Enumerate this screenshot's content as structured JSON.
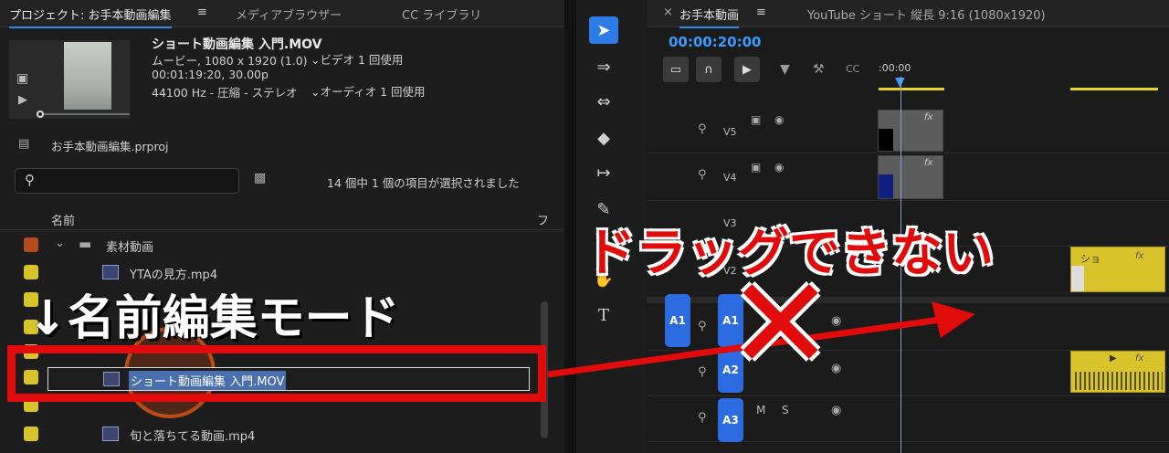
{
  "project_panel": {
    "tabs": [
      "プロジェクト: お手本動画編集",
      "メディアブラウザー",
      "CC ライブラリ"
    ],
    "menu_glyph": "≡",
    "clip_name": "ショート動画編集 入門.MOV",
    "clip_type": "ムービー, 1080 x 1920 (1.0)",
    "video_usage": "ビデオ 1 回使用",
    "duration": "00:01:19:20, 30.00p",
    "audio_info": "44100 Hz - 圧縮 - ステレオ",
    "audio_usage": "オーディオ 1 回使用",
    "project_file": "お手本動画編集.prproj",
    "selection_status": "14 個中 1 個の項目が選択されました",
    "column_name": "名前",
    "column_frame": "フ",
    "items": [
      {
        "label": "素材動画",
        "kind": "folder",
        "color": "#b54a1e"
      },
      {
        "label": "YTAの見方.mp4",
        "kind": "clip",
        "color": "#d8c32a"
      },
      {
        "label": "",
        "kind": "clip",
        "color": "#d8c32a"
      },
      {
        "label": "",
        "kind": "clip",
        "color": "#d8c32a"
      },
      {
        "label": "",
        "kind": "clip",
        "color": "#d8c32a"
      },
      {
        "label": "ショート動画編集 入門.MOV",
        "kind": "clip-editing",
        "color": "#d8c32a"
      },
      {
        "label": "",
        "kind": "clip",
        "color": "#d8c32a"
      },
      {
        "label": "旬と落ちてる動画.mp4",
        "kind": "clip",
        "color": "#d8c32a"
      }
    ]
  },
  "toolbar": {
    "tools": [
      "selection-tool",
      "track-select-tool",
      "ripple-edit-tool",
      "razor-tool",
      "slip-tool",
      "pen-tool",
      "hand-tool",
      "type-tool"
    ]
  },
  "timeline": {
    "sequence_tab": "お手本動画",
    "sequence_info": "YouTube ショート 縦長 9:16 (1080x1920)",
    "timecode": "00:00:20:00",
    "ruler_start": ":00:00",
    "video_tracks": [
      "V5",
      "V4",
      "V3",
      "V2"
    ],
    "audio_tracks": [
      "A1",
      "A2",
      "A3"
    ],
    "source_patch": "A1",
    "mute_label": "M",
    "solo_label": "S",
    "fx_label": "fx",
    "clip_label": "ショ"
  },
  "overlay": {
    "rename_caption": "↓名前編集モード",
    "drag_caption": "ドラッグできない",
    "cross_mark": "✕",
    "colors": {
      "red": "#e10b0b",
      "accent_blue": "#2d7ce8",
      "label_yellow": "#d8c32a"
    }
  }
}
